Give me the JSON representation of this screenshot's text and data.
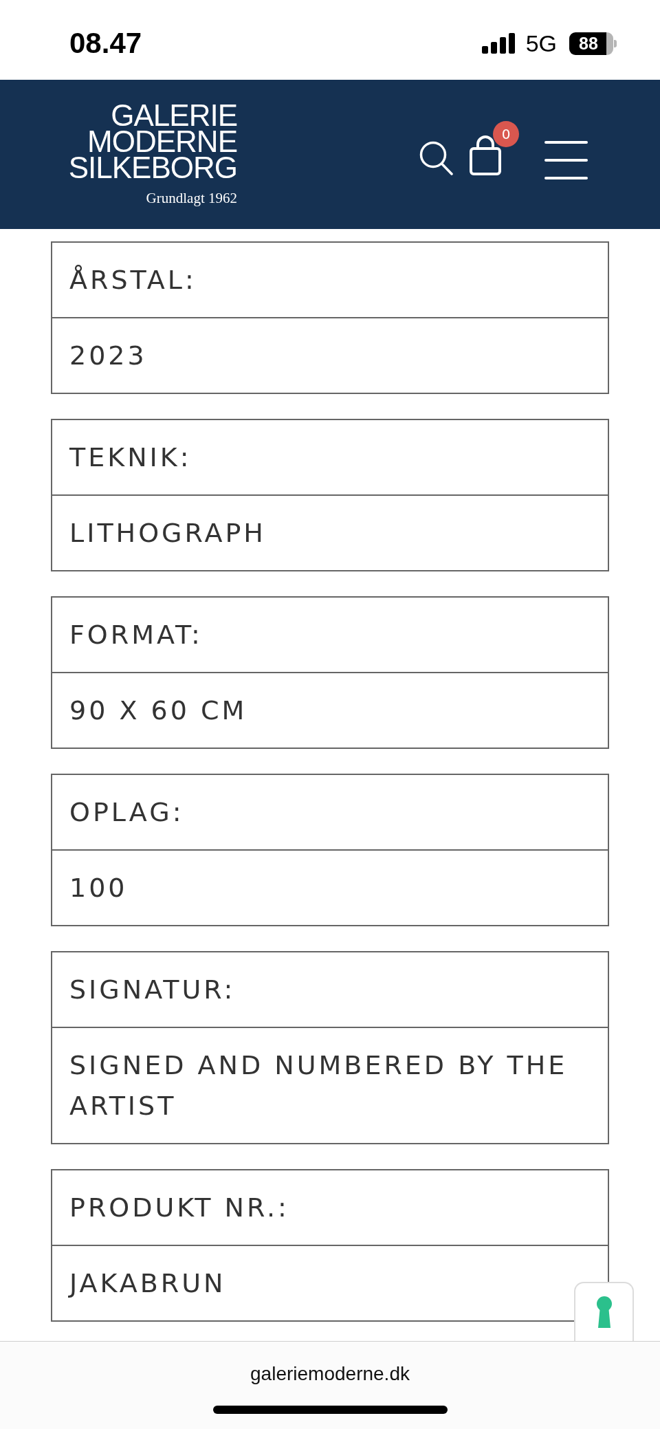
{
  "status_bar": {
    "time": "08.47",
    "network": "5G",
    "battery": "88"
  },
  "header": {
    "logo": "GALERIE MODERNE SILKEBORG",
    "tagline": "Grundlagt 1962",
    "cart_count": "0"
  },
  "specs": [
    {
      "label": "ÅRSTAL:",
      "value": "2023"
    },
    {
      "label": "TEKNIK:",
      "value": "LITHOGRAPH"
    },
    {
      "label": "FORMAT:",
      "value": "90 X 60 CM"
    },
    {
      "label": "OPLAG:",
      "value": "100"
    },
    {
      "label": "SIGNATUR:",
      "value": "SIGNED AND NUMBERED BY THE ARTIST"
    },
    {
      "label": "PRODUKT NR.:",
      "value": "JAKABRUN"
    }
  ],
  "browser_bar": {
    "url": "galeriemoderne.dk"
  }
}
